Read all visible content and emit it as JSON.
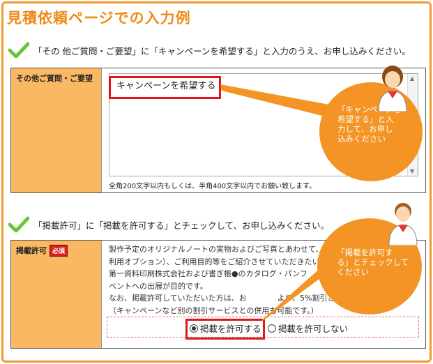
{
  "title": "見積依頼ページでの入力例",
  "section1": {
    "instruction": "「その 他ご質問・ご要望」に「キャンペーンを希望する」と入力のうえ、お申し込みください。",
    "field_label": "その他ご質問・ご要望",
    "textarea_value": "キャンペーンを希望する",
    "note": "全角200文字以内もしくは、半角400文字以内でお願い致します。",
    "bubble": "「キャンペーンを\n希望する」と入\n力して、お申し\n込みください"
  },
  "section2": {
    "instruction": "「掲載許可」に「掲載を許可する」とチェックして、お申し込みください。",
    "field_label": "掲載許可",
    "required_badge": "必須",
    "body": "製作予定のオリジナルノートの実物およびご写真とあわせて、貴社名、ご\n利用オプション）、ご利用目的等をご紹介させていただきたいと考えて\n第一資料印刷株式会社および書ぎ帳●のカタログ・パンフ\nベントへの出展が目的です。\nなお、掲載許可していただいた方は、お　　　　より、5%割引させていただ\n（キャンペーンなど別の割引サービスとの併用も可能です。）",
    "options": [
      "掲載を許可する",
      "掲載を許可しない"
    ],
    "selected": 0,
    "bubble": "「掲載を許可す\nる」とチェックして\nください"
  },
  "colors": {
    "accent": "#ef8a17",
    "highlight": "#e3141b",
    "label_bg": "#fbb862"
  }
}
